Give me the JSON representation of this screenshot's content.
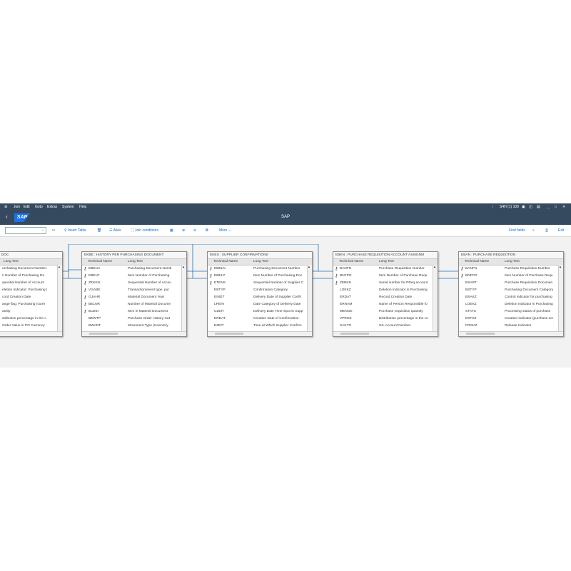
{
  "menu": {
    "items": [
      "Join",
      "Edit",
      "Goto",
      "Extras",
      "System",
      "Help"
    ],
    "system_info": "S4H (1) 100"
  },
  "shell": {
    "logo": "SAP",
    "title": "SAP"
  },
  "toolbar": {
    "select_value": "",
    "insert_table": "Insert Table",
    "alias": "Alias",
    "join_conditions": "Join conditions",
    "more": "More",
    "find_fields": "Find fields",
    "exit": "Exit"
  },
  "columns": {
    "technical": "Technical Name",
    "long": "Long Text"
  },
  "tables": [
    {
      "title": "UMENT IN PURCHASING DOC",
      "rows": [
        [
          "",
          "urchasing Document Number"
        ],
        [
          "",
          "n Number of Purchasing Do"
        ],
        [
          "",
          "quential Number of Account"
        ],
        [
          "",
          "eletion Indicator: Purchasing I"
        ],
        [
          "",
          "cord Creation Date"
        ],
        [
          "",
          "ange flag: Purchasing (curre"
        ],
        [
          "",
          "antity"
        ],
        [
          "",
          "stribution percentage in the c"
        ],
        [
          "",
          "Order Value in PO Currency"
        ]
      ]
    },
    {
      "title": "EKBE : HISTORY PER PURCHASING DOCUMENT",
      "rows": [
        [
          "EBELN",
          "Purchasing Document Numb"
        ],
        [
          "EBELP",
          "Item Number of Purchasing"
        ],
        [
          "ZEKKN",
          "Sequential Number of Accou"
        ],
        [
          "VGABE",
          "Transaction/event type, pur"
        ],
        [
          "GJAHR",
          "Material Document Year"
        ],
        [
          "BELNR",
          "Number of Material Docume"
        ],
        [
          "BUZEI",
          "Item in Material Document"
        ],
        [
          "BEWTP",
          "Purchase Order History Cat"
        ],
        [
          "BWART",
          "Movement Type (Inventory"
        ]
      ]
    },
    {
      "title": "EKES : SUPPLIER CONFIRMATIONS",
      "rows": [
        [
          "EBELN",
          "Purchasing Document Number"
        ],
        [
          "EBELP",
          "Item Number of Purchasing Doc"
        ],
        [
          "ETENS",
          "Sequential Number of Supplier C"
        ],
        [
          "EBTYP",
          "Confirmation Category"
        ],
        [
          "EINDT",
          "Delivery Date of Supplier Confir"
        ],
        [
          "LPEIN",
          "Date Category of Delivery Date"
        ],
        [
          "UZEIT",
          "Delivery Date Time-Spot in Supp"
        ],
        [
          "ERDAT",
          "Creation Date of Confirmation"
        ],
        [
          "EZEIT",
          "Time at Which Supplier Confirm"
        ]
      ]
    },
    {
      "title": "EBKN : PURCHASE REQUISITION ACCOUNT ASSIGNM",
      "rows": [
        [
          "BANFN",
          "Purchase Requisition Number"
        ],
        [
          "BNFPO",
          "Item Number of Purchase Requ"
        ],
        [
          "ZEBKN",
          "Serial number for PReq account"
        ],
        [
          "LOEKZ",
          "Deletion Indicator in Purchasing"
        ],
        [
          "ERDAT",
          "Record Creation Date"
        ],
        [
          "ERNAM",
          "Name of Person Responsible fo"
        ],
        [
          "MENGE",
          "Purchase requisition quantity"
        ],
        [
          "VPROZ",
          "Distribution percentage in the co"
        ],
        [
          "SAKTO",
          "G/L Account Number"
        ]
      ]
    },
    {
      "title": "EBAN : PURCHASE REQUISITION",
      "rows": [
        [
          "BANFN",
          "Purchase Requisition Number"
        ],
        [
          "BNFPO",
          "Item Number of Purchase Requ"
        ],
        [
          "BSART",
          "Purchase Requisition Documen"
        ],
        [
          "BSTYP",
          "Purchasing Document Category"
        ],
        [
          "BSAKZ",
          "Control indicator for purchasing"
        ],
        [
          "LOEKZ",
          "Deletion Indicator in Purchasing"
        ],
        [
          "STATU",
          "Processing status of purchase"
        ],
        [
          "ESTKZ",
          "Creation indicator (purchase rec"
        ],
        [
          "FRGKZ",
          "Release Indicator"
        ]
      ]
    }
  ]
}
